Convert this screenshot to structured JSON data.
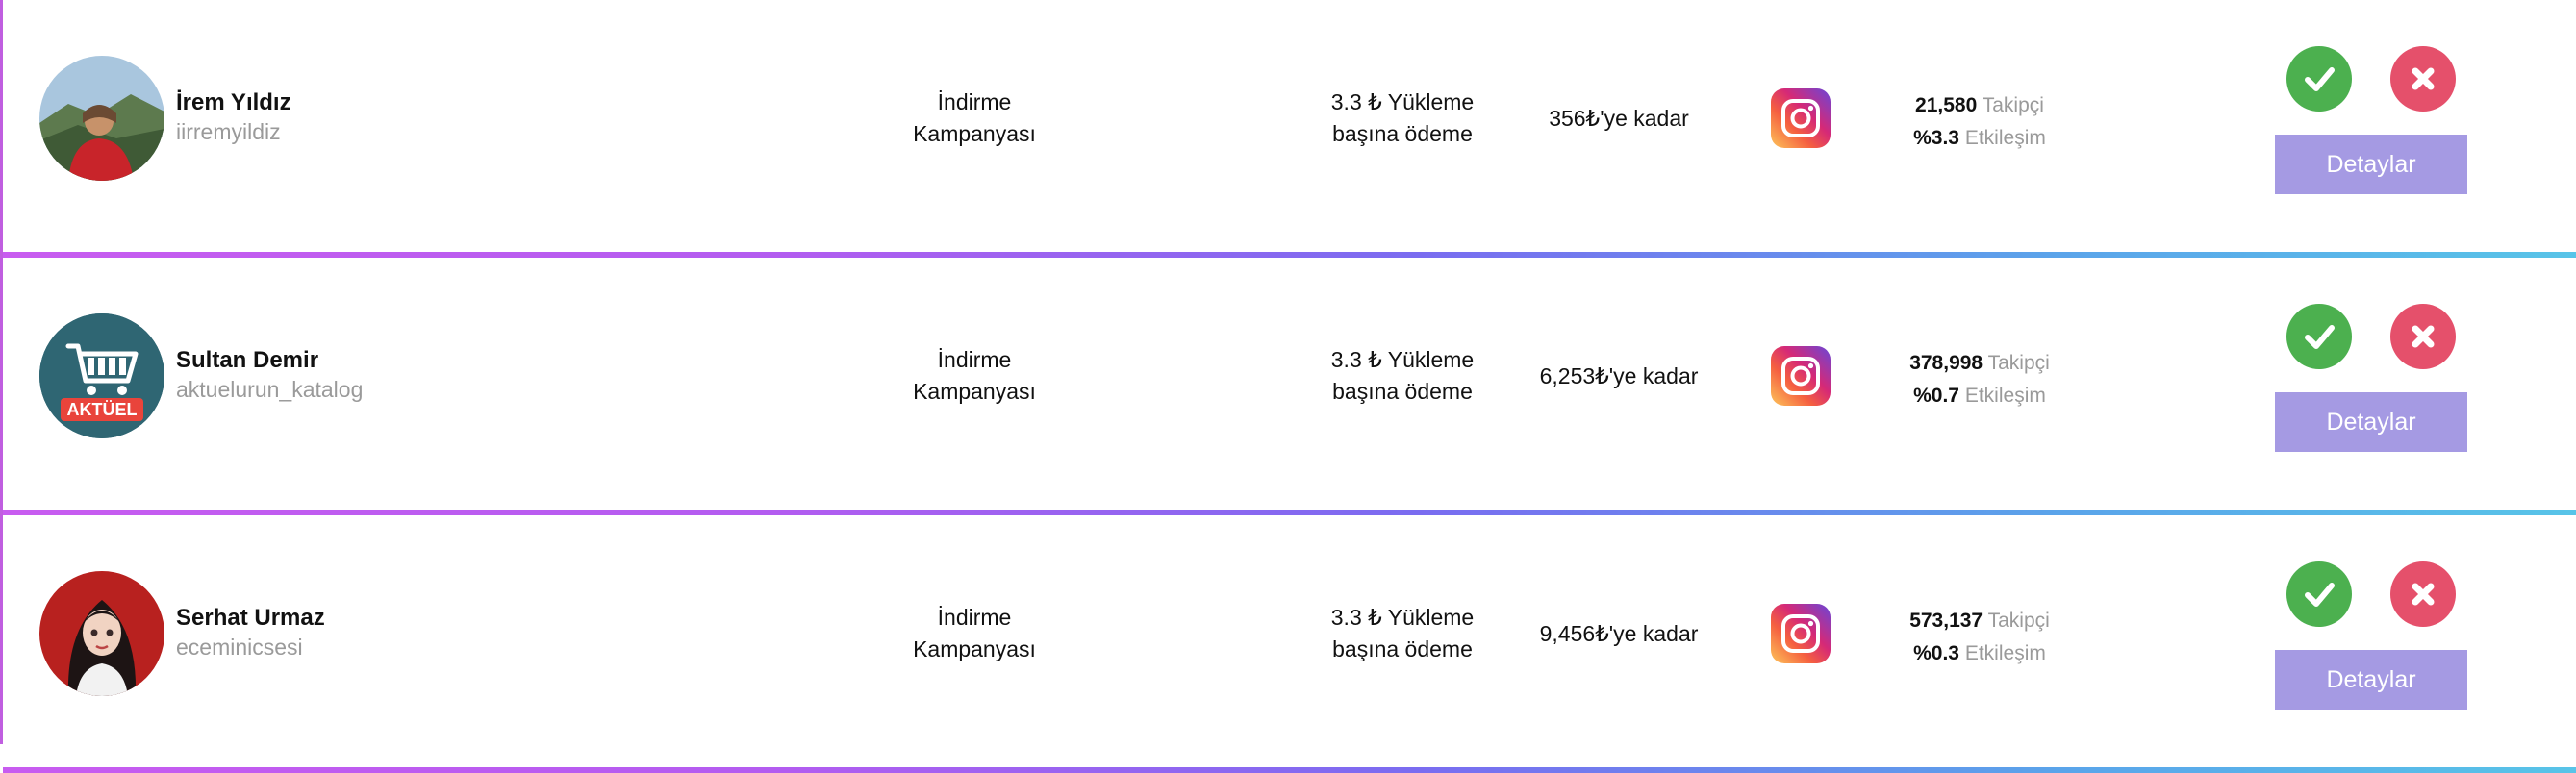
{
  "rows": [
    {
      "name": "İrem Yıldız",
      "handle": "iirremyildiz",
      "campaign": [
        "İndirme",
        "Kampanyası"
      ],
      "payment": [
        "3.3 ₺ Yükleme",
        "başına ödeme"
      ],
      "limit": "356₺'ye kadar",
      "platform_icon": "instagram-icon",
      "followers": "21,580",
      "followers_label": "Takipçi",
      "engagement": "%3.3",
      "engagement_label": "Etkileşim",
      "approve_icon": "check-icon",
      "reject_icon": "close-icon",
      "details_label": "Detaylar"
    },
    {
      "name": "Sultan Demir",
      "handle": "aktuelurun_katalog",
      "avatar_text": "AKTÜEL",
      "campaign": [
        "İndirme",
        "Kampanyası"
      ],
      "payment": [
        "3.3 ₺ Yükleme",
        "başına ödeme"
      ],
      "limit": "6,253₺'ye kadar",
      "platform_icon": "instagram-icon",
      "followers": "378,998",
      "followers_label": "Takipçi",
      "engagement": "%0.7",
      "engagement_label": "Etkileşim",
      "approve_icon": "check-icon",
      "reject_icon": "close-icon",
      "details_label": "Detaylar"
    },
    {
      "name": "Serhat Urmaz",
      "handle": "eceminicsesi",
      "campaign": [
        "İndirme",
        "Kampanyası"
      ],
      "payment": [
        "3.3 ₺ Yükleme",
        "başına ödeme"
      ],
      "limit": "9,456₺'ye kadar",
      "platform_icon": "instagram-icon",
      "followers": "573,137",
      "followers_label": "Takipçi",
      "engagement": "%0.3",
      "engagement_label": "Etkileşim",
      "approve_icon": "check-icon",
      "reject_icon": "close-icon",
      "details_label": "Detaylar"
    }
  ],
  "colors": {
    "approve": "#4cb04f",
    "reject": "#e5506b",
    "details_button": "#a59ae3",
    "muted_text": "#9a9a9a",
    "divider_start": "#c85cf0",
    "divider_end": "#58c4e8"
  }
}
